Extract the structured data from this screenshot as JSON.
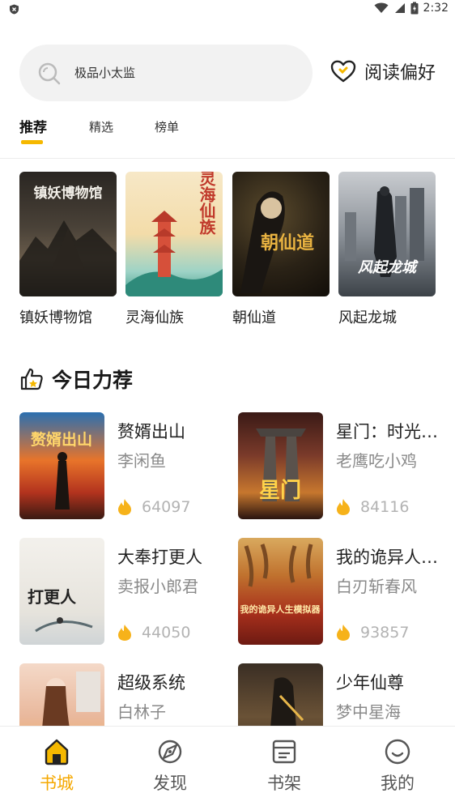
{
  "status_bar": {
    "time": "2:32"
  },
  "search": {
    "placeholder_text": "极品小太监"
  },
  "preference": {
    "label": "阅读偏好"
  },
  "tabs": [
    {
      "label": "推荐",
      "active": true
    },
    {
      "label": "精选",
      "active": false
    },
    {
      "label": "榜单",
      "active": false
    }
  ],
  "recommended": [
    {
      "title": "镇妖博物馆",
      "cover_text": "镇妖博物馆"
    },
    {
      "title": "灵海仙族",
      "cover_text": "灵海仙族"
    },
    {
      "title": "朝仙道",
      "cover_text": "朝仙道"
    },
    {
      "title": "风起龙城",
      "cover_text": "风起龙城"
    }
  ],
  "today_section": {
    "title": "今日力荐",
    "books": [
      {
        "name": "赘婿出山",
        "author": "李闲鱼",
        "heat": "64097",
        "cover_text": "赘婿出山"
      },
      {
        "name": "星门：时光…",
        "author": "老鹰吃小鸡",
        "heat": "84116",
        "cover_text": "星门"
      },
      {
        "name": "大奉打更人",
        "author": "卖报小郎君",
        "heat": "44050",
        "cover_text": "打更人"
      },
      {
        "name": "我的诡异人…",
        "author": "白刃斩春风",
        "heat": "93857",
        "cover_text": "我的诡异人生模拟器"
      },
      {
        "name": "超级系统",
        "author": "白林子",
        "heat": "",
        "cover_text": ""
      },
      {
        "name": "少年仙尊",
        "author": "梦中星海",
        "heat": "",
        "cover_text": ""
      }
    ]
  },
  "bottom_nav": [
    {
      "label": "书城",
      "icon": "home-icon",
      "active": true
    },
    {
      "label": "发现",
      "icon": "discover-icon",
      "active": false
    },
    {
      "label": "书架",
      "icon": "bookshelf-icon",
      "active": false
    },
    {
      "label": "我的",
      "icon": "profile-icon",
      "active": false
    }
  ],
  "colors": {
    "accent": "#f5b800",
    "active_nav": "#f5a800",
    "muted": "#8a8a8a"
  }
}
